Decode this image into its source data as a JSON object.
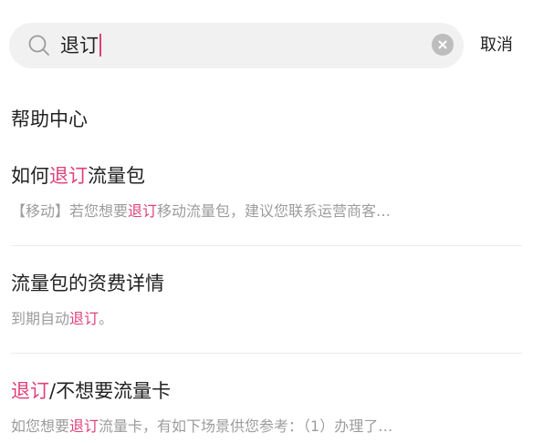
{
  "search": {
    "value": "退订"
  },
  "cancel_label": "取消",
  "section_title": "帮助中心",
  "results": [
    {
      "title_pre": "如何",
      "title_hl": "退订",
      "title_post": "流量包",
      "snippet_pre": "【移动】若您想要",
      "snippet_hl": "退订",
      "snippet_post": "移动流量包，建议您联系运营商客…"
    },
    {
      "title_pre": "流量包的资费详情",
      "title_hl": "",
      "title_post": "",
      "snippet_pre": "到期自动",
      "snippet_hl": "退订",
      "snippet_post": "。"
    },
    {
      "title_pre": "",
      "title_hl": "退订",
      "title_post": "/不想要流量卡",
      "snippet_pre": "如您想要",
      "snippet_hl": "退订",
      "snippet_post": "流量卡，有如下场景供您参考：（1）办理了…"
    }
  ],
  "colors": {
    "highlight": "#e0407a",
    "search_bg": "#f1f1f1",
    "snippet": "#9c9c9c"
  }
}
